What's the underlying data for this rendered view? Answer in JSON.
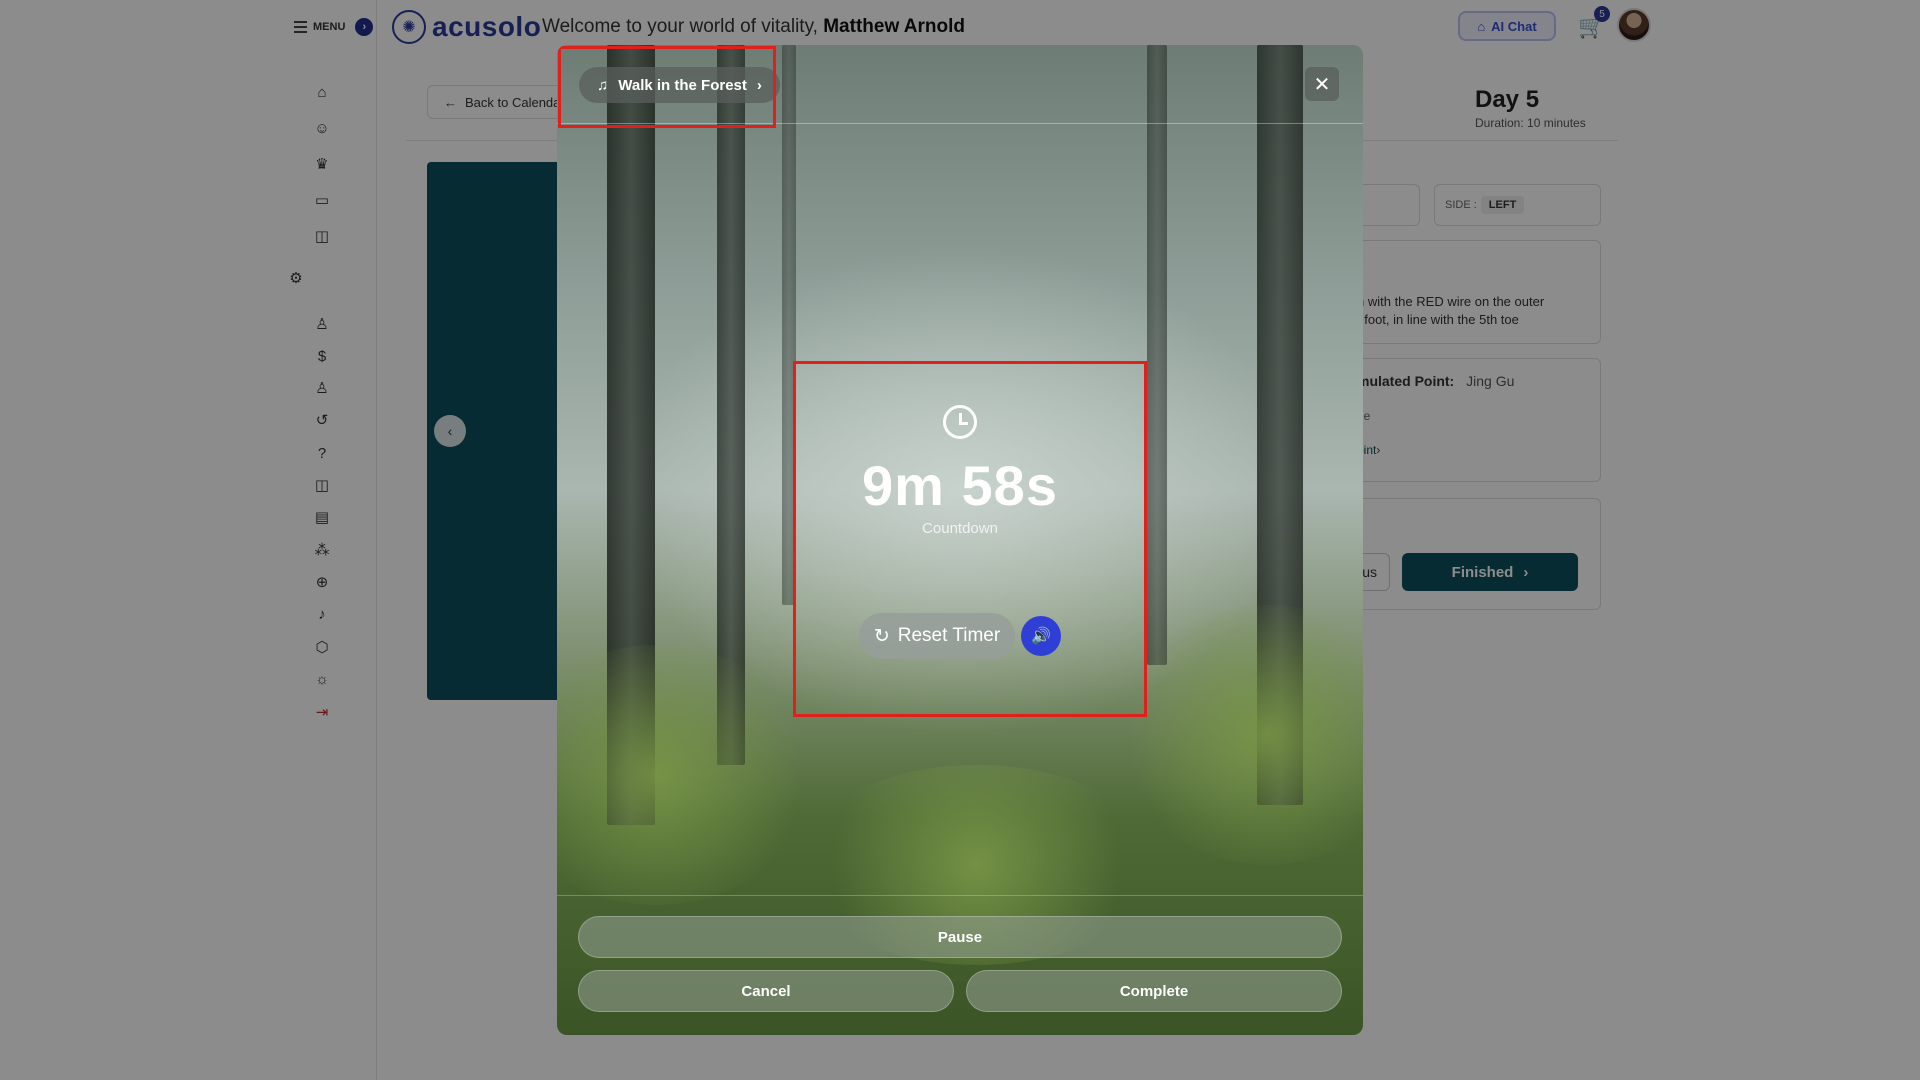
{
  "header": {
    "menu_label": "MENU",
    "logo_text": "acusolo",
    "welcome_prefix": "Welcome to your world of vitality,",
    "user_name": "Matthew Arnold",
    "ai_chat_label": "AI Chat",
    "cart_count": "5"
  },
  "page": {
    "back_label": "Back to Calendar",
    "day_title": "Day 5",
    "duration": "Duration: 10 minutes",
    "side_label": "SIDE :",
    "side_value": "LEFT",
    "instruction_line1": "h with the RED wire on the outer",
    "instruction_line2": "t foot, in line with the 5th toe",
    "stimulated_label": "mulated Point:",
    "stimulated_value": "Jing Gu",
    "fragment_ne": "ne",
    "point_link": "oint›",
    "prev_label": "us",
    "finished_label": "Finished"
  },
  "modal": {
    "track_name": "Walk in the Forest",
    "timer_value": "9m 58s",
    "timer_label": "Countdown",
    "reset_label": "Reset Timer",
    "pause_label": "Pause",
    "cancel_label": "Cancel",
    "complete_label": "Complete"
  },
  "icons": {
    "music": "music-note-icon",
    "chevron": "chevron-right-icon",
    "close": "close-icon",
    "clock": "clock-icon",
    "reset": "refresh-icon",
    "sound": "speaker-icon"
  },
  "colors": {
    "brand": "#2a3a9c",
    "teal": "#0d4f5c",
    "sound_button": "#2f3fd6",
    "highlight": "#e0201c"
  }
}
